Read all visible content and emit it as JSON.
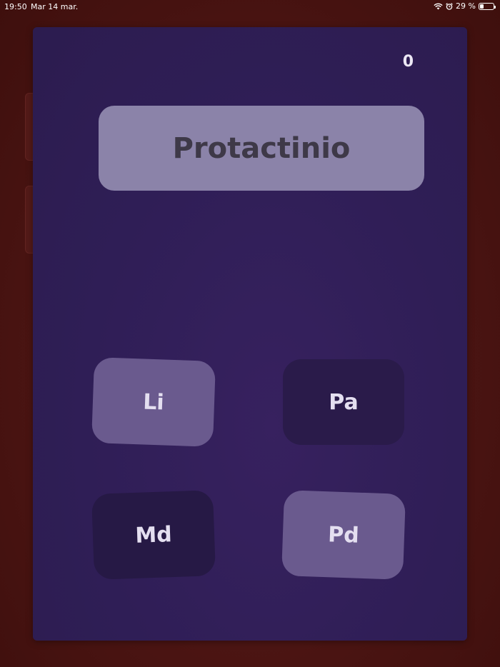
{
  "status_bar": {
    "time": "19:50",
    "date": "Mar 14 mar.",
    "battery_text": "29 %",
    "battery_level": 0.29,
    "icons": [
      "wifi-icon",
      "alarm-icon",
      "battery-icon"
    ]
  },
  "game": {
    "score": "0",
    "prompt": "Protactinio",
    "answers": [
      {
        "symbol": "Li"
      },
      {
        "symbol": "Pa"
      },
      {
        "symbol": "Md"
      },
      {
        "symbol": "Pd"
      }
    ]
  },
  "colors": {
    "background": "#4a1412",
    "card": "#2f1e56",
    "prompt_box": "#8b83a9",
    "answer_light": "#6a5a8e",
    "answer_dark": "#2a1b4a"
  }
}
